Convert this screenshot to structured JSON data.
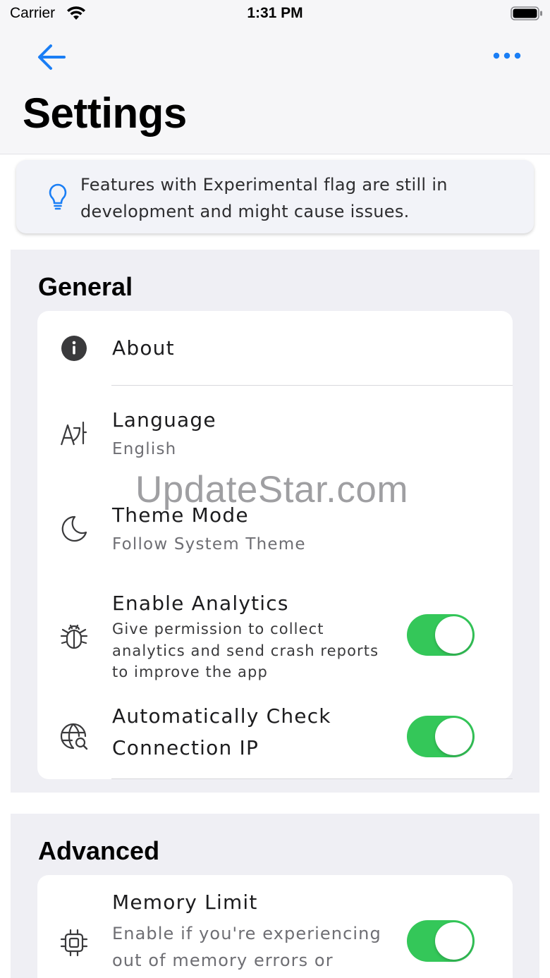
{
  "status_bar": {
    "carrier": "Carrier",
    "time": "1:31 PM"
  },
  "navbar": {
    "title": "Settings",
    "back_icon": "arrow-left-icon",
    "more_icon": "ellipsis-icon",
    "accent_color": "#1a7ef5"
  },
  "banner": {
    "icon": "lightbulb-icon",
    "text": "Features with Experimental flag are still in development and might cause issues."
  },
  "general": {
    "title": "General",
    "items": [
      {
        "icon": "info-circle-icon",
        "title": "About"
      },
      {
        "icon": "language-icon",
        "title": "Language",
        "subtitle": "English"
      },
      {
        "icon": "moon-icon",
        "title": "Theme Mode",
        "subtitle": "Follow System Theme"
      },
      {
        "icon": "bug-icon",
        "title": "Enable Analytics",
        "description": "Give permission to collect analytics and send crash reports to improve the app",
        "toggle_on": true
      },
      {
        "icon": "globe-search-icon",
        "title": "Automatically Check Connection IP",
        "toggle_on": true
      }
    ]
  },
  "advanced": {
    "title": "Advanced",
    "items": [
      {
        "icon": "chip-icon",
        "title": "Memory Limit",
        "description": "Enable if you're experiencing out of memory errors or",
        "toggle_on": true
      }
    ]
  },
  "watermark": "UpdateStar.com",
  "colors": {
    "toggle_on": "#34c759",
    "section_bg": "#efeff4",
    "card_bg": "#ffffff"
  }
}
